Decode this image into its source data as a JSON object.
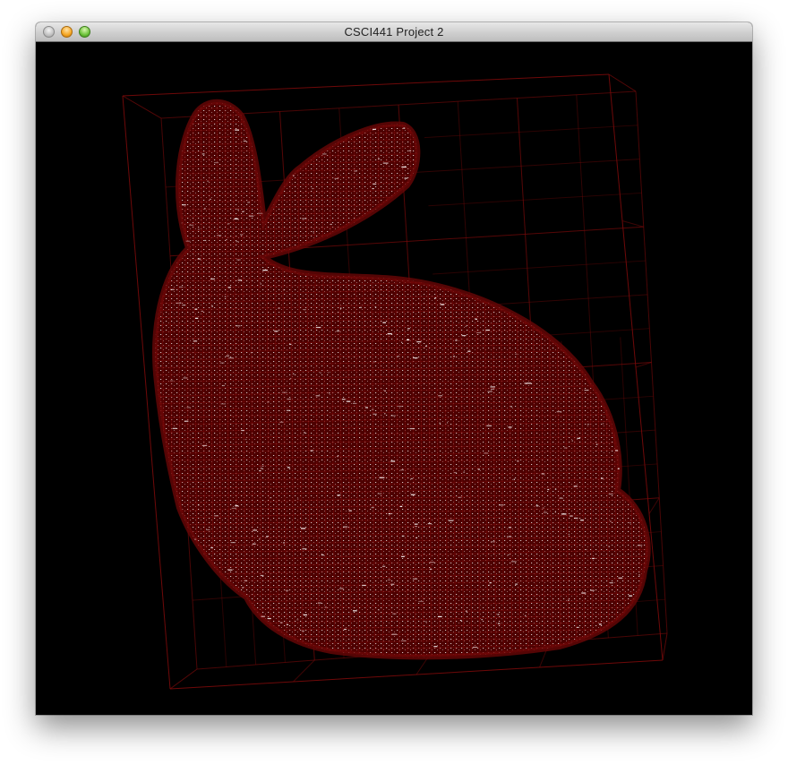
{
  "window": {
    "title": "CSCI441 Project 2"
  },
  "controls": {
    "close": "close-icon",
    "minimize": "minimize-icon",
    "zoom": "zoom-icon"
  },
  "scene": {
    "background_color": "#000000",
    "wire_color": "#7a0a0a",
    "fill_color": "#4d0000",
    "highlight_color": "#ffffff",
    "subject": "octree wireframe of Stanford bunny"
  }
}
